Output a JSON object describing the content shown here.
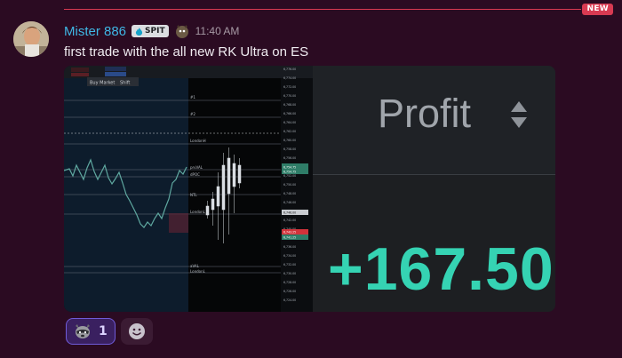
{
  "badge": {
    "new_label": "NEW"
  },
  "author": {
    "username": "Mister 886",
    "role_tag": "SPIT",
    "timestamp": "11:40 AM"
  },
  "message": {
    "text": "first trade with the all new RK Ultra on ES"
  },
  "attachment": {
    "chart": {
      "order_label": "Buy Market",
      "shift_label": "Shift",
      "lines": [
        "#1",
        "#2",
        "LondonH",
        "prvVAL",
        "dPOC",
        "NTL",
        "LondonL",
        "aVAL",
        "LondonL"
      ],
      "prices": [
        "6,776.00",
        "6,774.00",
        "6,772.00",
        "6,770.00",
        "6,768.00",
        "6,766.00",
        "6,764.00",
        "6,762.00",
        "6,760.00",
        "6,758.00",
        "6,756.00",
        "6,754.00",
        "6,752.00",
        "6,750.00",
        "6,748.00",
        "6,746.00",
        "6,744.00",
        "6,742.00",
        "6,740.00",
        "6,738.00",
        "6,736.00",
        "6,734.00",
        "6,732.00",
        "6,730.00",
        "6,728.00",
        "6,726.00",
        "6,724.00"
      ],
      "tags": [
        "6,754.75",
        "6,754.75",
        "6,746.00",
        "6,743.25",
        "6,741.25"
      ]
    },
    "profit_label": "Profit",
    "profit_value": "+167.50"
  },
  "reactions": [
    {
      "emoji": "raccoon-emoji",
      "count": "1"
    }
  ],
  "colors": {
    "background": "#2b0b22",
    "username": "#3fb8e6",
    "profit_value": "#35d3b3",
    "new_badge": "#d83a52"
  }
}
